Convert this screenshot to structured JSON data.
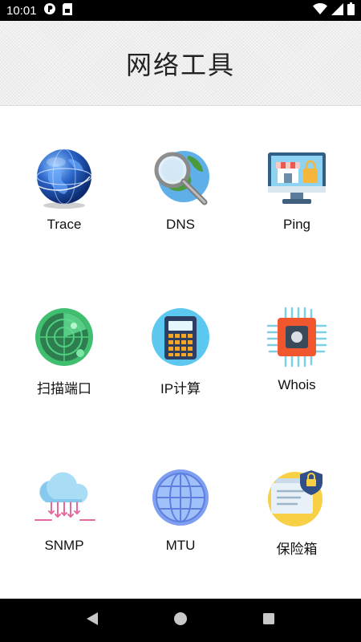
{
  "status_bar": {
    "time": "10:01",
    "icons": [
      "notification-icon",
      "sim-card-icon",
      "wifi-icon",
      "signal-icon",
      "battery-icon"
    ]
  },
  "header": {
    "title": "网络工具"
  },
  "tools": [
    {
      "label": "Trace",
      "icon": "globe-icon"
    },
    {
      "label": "DNS",
      "icon": "magnifier-globe-icon"
    },
    {
      "label": "Ping",
      "icon": "monitor-store-icon"
    },
    {
      "label": "扫描端口",
      "icon": "radar-icon"
    },
    {
      "label": "IP计算",
      "icon": "calculator-icon"
    },
    {
      "label": "Whois",
      "icon": "chip-icon"
    },
    {
      "label": "SNMP",
      "icon": "cloud-network-icon"
    },
    {
      "label": "MTU",
      "icon": "network-globe-icon"
    },
    {
      "label": "保险箱",
      "icon": "secure-document-icon"
    }
  ],
  "nav_bar": {
    "buttons": [
      "back-icon",
      "home-icon",
      "recents-icon"
    ]
  },
  "colors": {
    "status_bar": "#000000",
    "header_bg": "#f4f4f4",
    "nav_bar": "#000000"
  }
}
